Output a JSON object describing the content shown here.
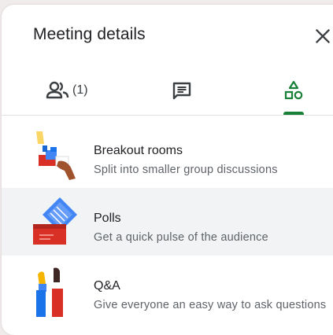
{
  "header": {
    "title": "Meeting details"
  },
  "tabs": {
    "people_count": "(1)",
    "active": "activities"
  },
  "activities": [
    {
      "title": "Breakout rooms",
      "subtitle": "Split into smaller group discussions"
    },
    {
      "title": "Polls",
      "subtitle": "Get a quick pulse of the audience"
    },
    {
      "title": "Q&A",
      "subtitle": "Give everyone an easy way to ask questions"
    }
  ],
  "colors": {
    "accent": "#188038",
    "text_primary": "#202124",
    "text_secondary": "#5f6368",
    "selected_row": "#f1f3f4"
  }
}
